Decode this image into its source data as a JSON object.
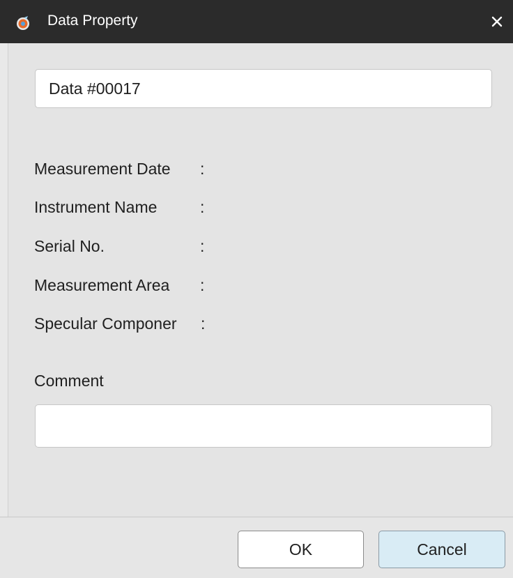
{
  "window": {
    "title": "Data Property",
    "close_symbol": "×"
  },
  "icons": {
    "app": "app-logo-icon",
    "close": "close-icon"
  },
  "form": {
    "data_name_value": "Data #00017",
    "properties": [
      {
        "label": "Measurement Date",
        "colon": ":"
      },
      {
        "label": "Instrument Name",
        "colon": ":"
      },
      {
        "label": "Serial No.",
        "colon": ":"
      },
      {
        "label": "Measurement Area",
        "colon": ":"
      },
      {
        "label": "Specular Componer",
        "colon": ":"
      }
    ],
    "comment_label": "Comment",
    "comment_value": ""
  },
  "buttons": {
    "ok_label": "OK",
    "cancel_label": "Cancel"
  },
  "colors": {
    "titlebar": "#2b2b2b",
    "background": "#e4e4e4",
    "cancel_accent": "#d9ecf5"
  }
}
